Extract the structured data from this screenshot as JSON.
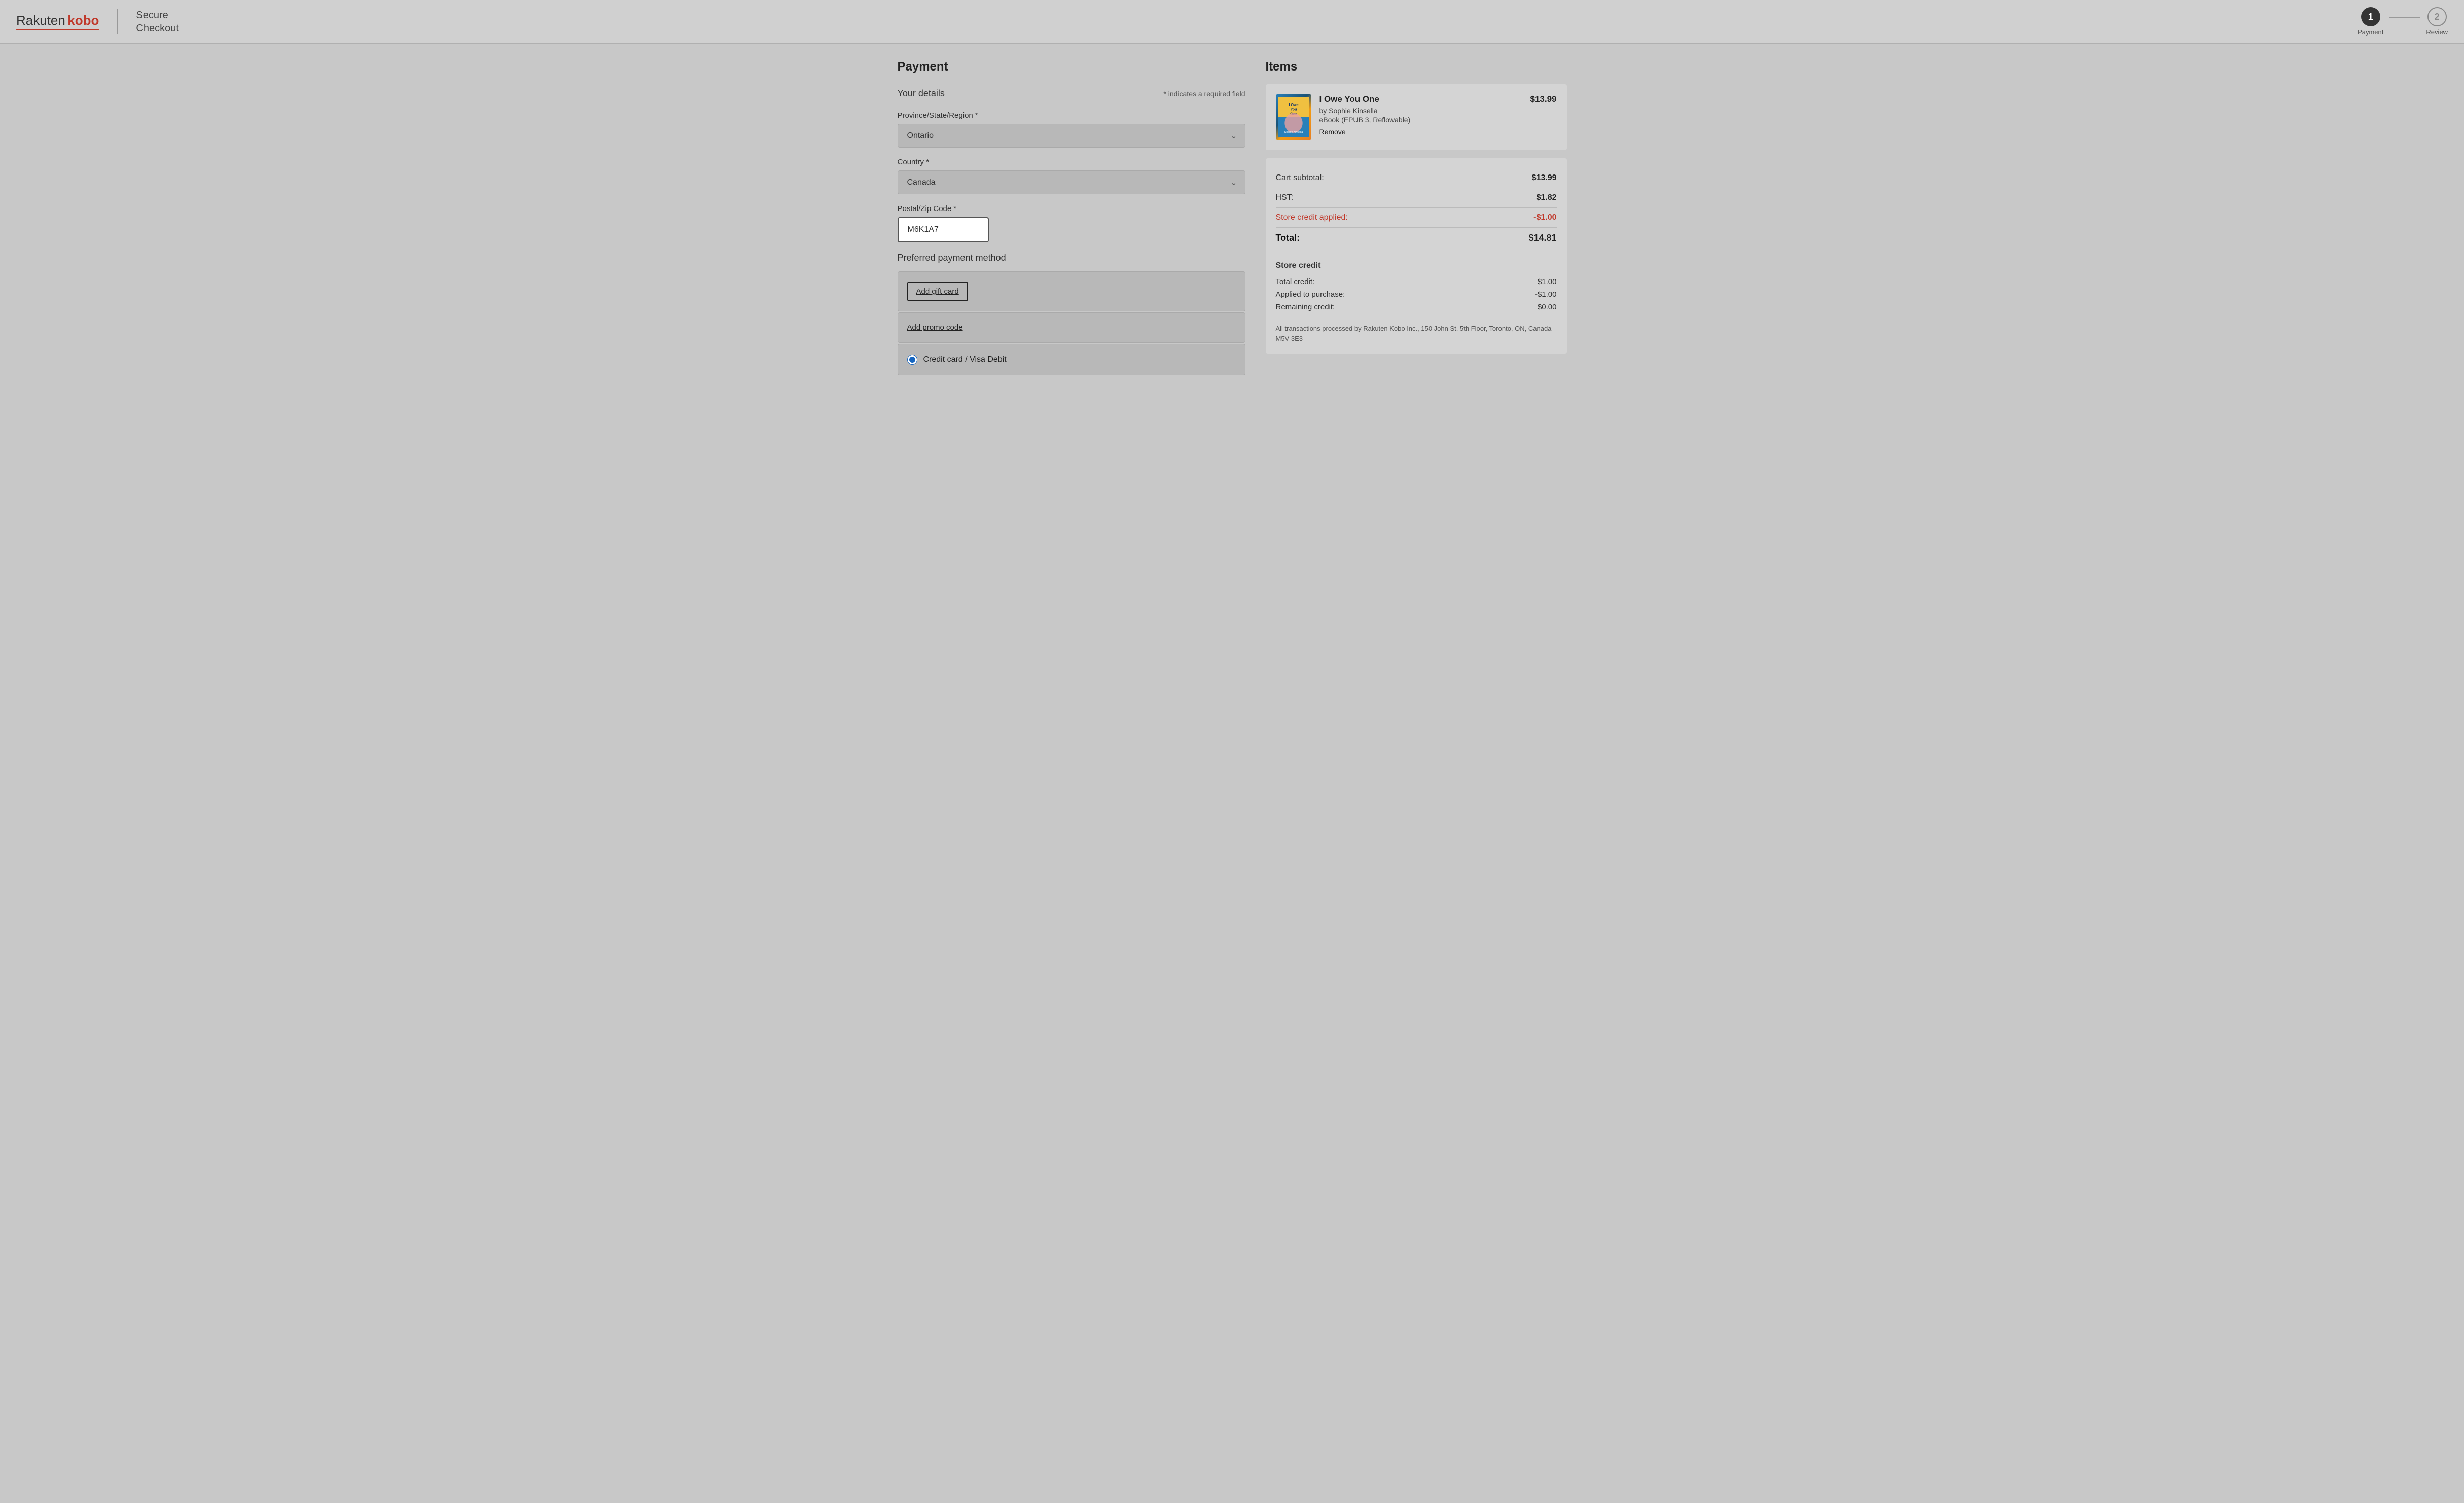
{
  "header": {
    "logo_rakuten": "Rakuten",
    "logo_kobo": "kobo",
    "secure_checkout": "Secure\nCheckout",
    "step1_number": "1",
    "step1_label": "Payment",
    "step2_number": "2",
    "step2_label": "Review"
  },
  "payment": {
    "section_title": "Payment",
    "your_details_title": "Your details",
    "required_note": "* indicates a required field",
    "province_label": "Province/State/Region *",
    "province_value": "Ontario",
    "country_label": "Country *",
    "country_value": "Canada",
    "postal_label": "Postal/Zip Code *",
    "postal_value": "M6K1A7",
    "preferred_payment_title": "Preferred payment method",
    "add_gift_card_label": "Add gift card",
    "add_promo_label": "Add promo code",
    "credit_card_label": "Credit card / Visa Debit"
  },
  "items": {
    "section_title": "Items",
    "book": {
      "title": "I Owe You One",
      "author": "by Sophie Kinsella",
      "format": "eBook (EPUB 3, Reflowable)",
      "price": "$13.99",
      "remove_label": "Remove",
      "cover_text": "I Owe You One"
    },
    "cart_subtotal_label": "Cart subtotal:",
    "cart_subtotal_value": "$13.99",
    "hst_label": "HST:",
    "hst_value": "$1.82",
    "store_credit_applied_label": "Store credit applied:",
    "store_credit_applied_value": "-$1.00",
    "total_label": "Total:",
    "total_value": "$14.81",
    "store_credit_section_title": "Store credit",
    "total_credit_label": "Total credit:",
    "total_credit_value": "$1.00",
    "applied_label": "Applied to purchase:",
    "applied_value": "-$1.00",
    "remaining_label": "Remaining credit:",
    "remaining_value": "$0.00",
    "transaction_note": "All transactions processed by Rakuten Kobo Inc., 150 John St. 5th Floor, Toronto, ON, Canada M5V 3E3"
  }
}
